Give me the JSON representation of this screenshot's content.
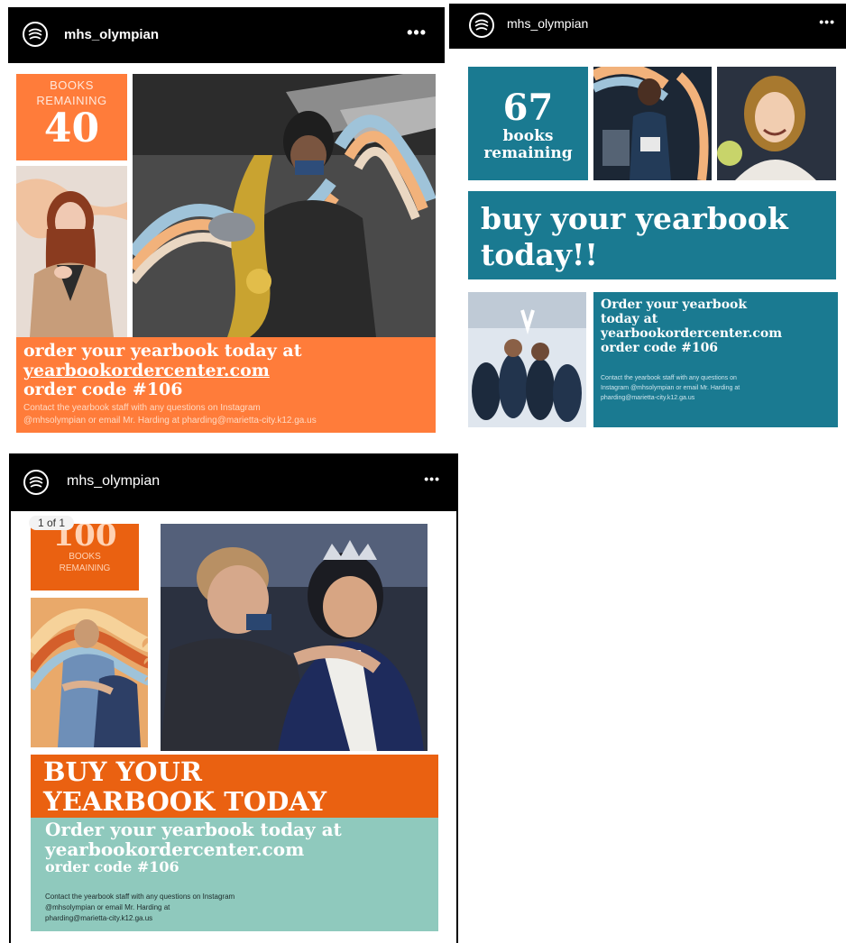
{
  "posts": [
    {
      "username": "mhs_olympian",
      "more": "•••",
      "counter_label": "BOOKS REMAINING",
      "counter_value": "40",
      "headline_line1": "order your yearbook today at",
      "headline_line2": "yearbookordercenter.com",
      "headline_line3": "order code #106",
      "contact_line1": "Contact the yearbook staff with any questions on Instagram",
      "contact_line2": "@mhsolympian or email Mr. Harding at pharding@marietta-city.k12.ga.us"
    },
    {
      "username": "mhs_olympian",
      "more": "•••",
      "counter_value": "67",
      "counter_label_line1": "books",
      "counter_label_line2": "remaining",
      "banner_line1": "buy your yearbook",
      "banner_line2": "today!!",
      "order_line1": "Order your yearbook",
      "order_line2": "today at",
      "order_line3": "yearbookordercenter.com",
      "order_line4": "order code #106",
      "contact_line1": "Contact the yearbook staff with any questions on",
      "contact_line2": "Instagram @mhsolympian or email Mr. Harding at",
      "contact_line3": "pharding@marietta-city.k12.ga.us"
    },
    {
      "username": "mhs_olympian",
      "more": "•••",
      "page_indicator": "1 of 1",
      "counter_value": "100",
      "counter_label_line1": "BOOKS",
      "counter_label_line2": "REMAINING",
      "banner_line1": "BUY YOUR",
      "banner_line2": "YEARBOOK TODAY",
      "order_line1": "Order your yearbook today at",
      "order_line2": "yearbookordercenter.com",
      "order_line3": "order code #106",
      "contact_line1": "Contact the yearbook staff with any questions on Instagram",
      "contact_line2": "@mhsolympian or email Mr. Harding at",
      "contact_line3": "pharding@marietta-city.k12.ga.us"
    }
  ],
  "colors": {
    "orange": "#ff7c3a",
    "deep_orange": "#ea6111",
    "teal": "#1a7a91",
    "sage": "#8fc9bd",
    "header": "#000000"
  }
}
